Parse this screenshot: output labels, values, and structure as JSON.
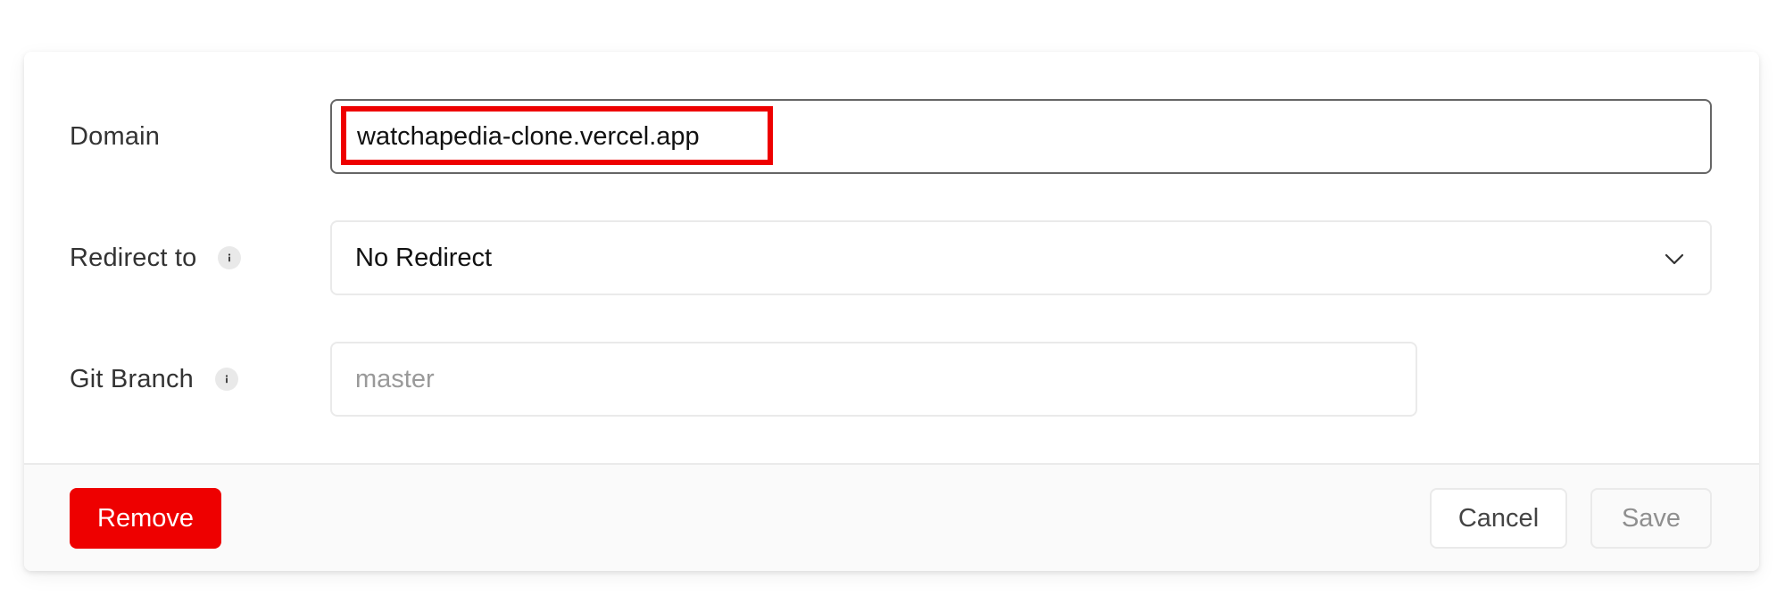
{
  "form": {
    "domain": {
      "label": "Domain",
      "value": "watchapedia-clone.vercel.app"
    },
    "redirect": {
      "label": "Redirect to",
      "info_icon": "info-icon",
      "selected": "No Redirect",
      "chevron_icon": "chevron-down-icon"
    },
    "branch": {
      "label": "Git Branch",
      "info_icon": "info-icon",
      "placeholder": "master"
    }
  },
  "footer": {
    "remove_label": "Remove",
    "cancel_label": "Cancel",
    "save_label": "Save"
  },
  "colors": {
    "danger": "#ee0000",
    "highlight": "#ee0000",
    "border": "#eaeaea",
    "footer_bg": "#fafafa"
  }
}
